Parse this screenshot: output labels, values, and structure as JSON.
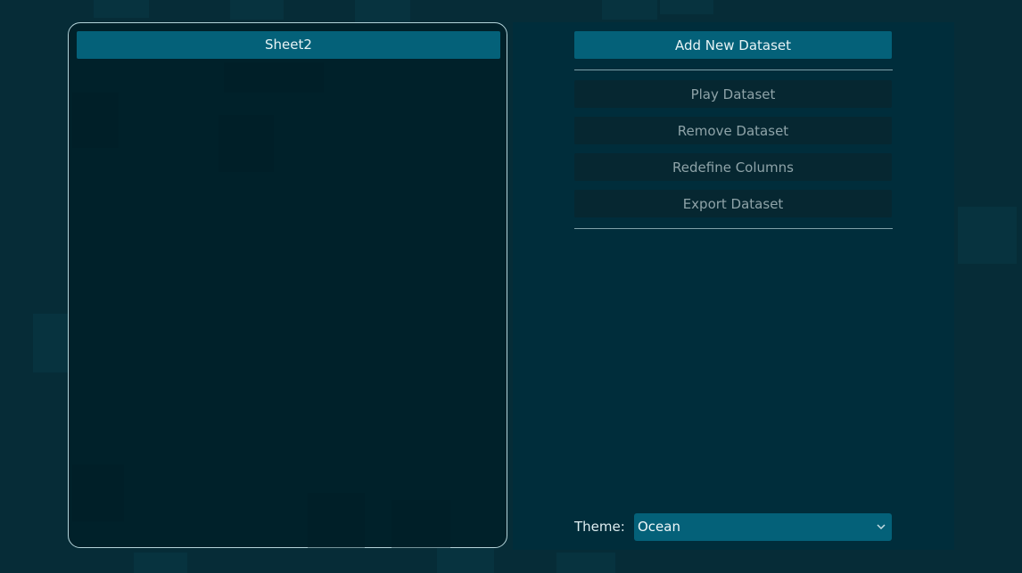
{
  "sheet_list": {
    "items": [
      {
        "label": "Sheet2"
      }
    ]
  },
  "actions": {
    "add_new": "Add New Dataset",
    "play": "Play Dataset",
    "remove": "Remove Dataset",
    "redefine": "Redefine Columns",
    "export": "Export Dataset"
  },
  "theme": {
    "label": "Theme:",
    "selected": "Ocean"
  },
  "colors": {
    "background": "#062c37",
    "panel": "#00212a",
    "side_panel": "#002d3b",
    "accent": "#046179",
    "disabled_button": "#062731"
  },
  "icons": {
    "dropdown": "chevron-down-icon"
  }
}
